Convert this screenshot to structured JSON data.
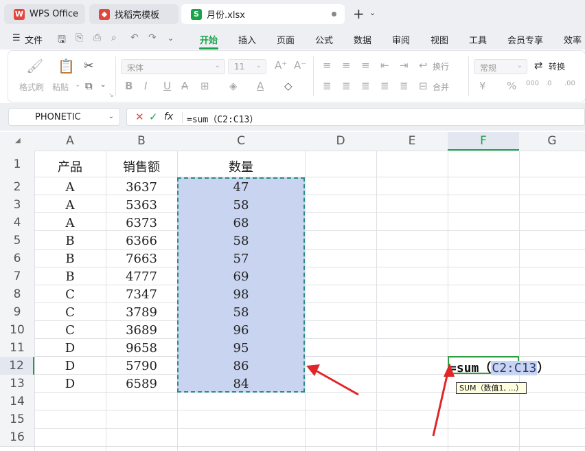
{
  "tabs": [
    {
      "label": "WPS Office",
      "icon": "wps-logo-icon",
      "color": "#e1473c"
    },
    {
      "label": "找稻壳模板",
      "icon": "daoke-logo-icon",
      "color": "#e1473c"
    },
    {
      "label": "月份.xlsx",
      "icon": "spreadsheet-icon",
      "color": "#1aa44a"
    }
  ],
  "menubar": {
    "file_label": "文件",
    "items": [
      "开始",
      "插入",
      "页面",
      "公式",
      "数据",
      "审阅",
      "视图",
      "工具",
      "会员专享",
      "效率"
    ],
    "active": "开始"
  },
  "ribbon": {
    "format_painter": "格式刷",
    "paste": "粘贴",
    "font_name": "宋体",
    "font_size": "11",
    "wrap": "换行",
    "merge": "合并",
    "number_format": "常规",
    "convert": "转换"
  },
  "formula_bar": {
    "name_box": "PHONETIC",
    "fx": "fx",
    "formula": "=sum（C2:C13）"
  },
  "columns": [
    "A",
    "B",
    "C",
    "D",
    "E",
    "F",
    "G"
  ],
  "rows": [
    "1",
    "2",
    "3",
    "4",
    "5",
    "6",
    "7",
    "8",
    "9",
    "10",
    "11",
    "12",
    "13",
    "14",
    "15",
    "16"
  ],
  "headers": [
    "产品",
    "销售额",
    "数量"
  ],
  "data": [
    [
      "A",
      "3637",
      "47"
    ],
    [
      "A",
      "5363",
      "58"
    ],
    [
      "A",
      "6373",
      "68"
    ],
    [
      "B",
      "6366",
      "58"
    ],
    [
      "B",
      "7663",
      "57"
    ],
    [
      "B",
      "4777",
      "69"
    ],
    [
      "C",
      "7347",
      "98"
    ],
    [
      "C",
      "3789",
      "58"
    ],
    [
      "C",
      "3689",
      "96"
    ],
    [
      "D",
      "9658",
      "95"
    ],
    [
      "D",
      "5790",
      "86"
    ],
    [
      "D",
      "6589",
      "84"
    ]
  ],
  "edit_cell": {
    "prefix": "=sum（",
    "ref": "C2:C13",
    "suffix": "）"
  },
  "tooltip": "SUM（数值1, ...）",
  "colors": {
    "accent": "#1aa44a",
    "selection": "#c8d4f0",
    "arrow": "#e0262a"
  }
}
